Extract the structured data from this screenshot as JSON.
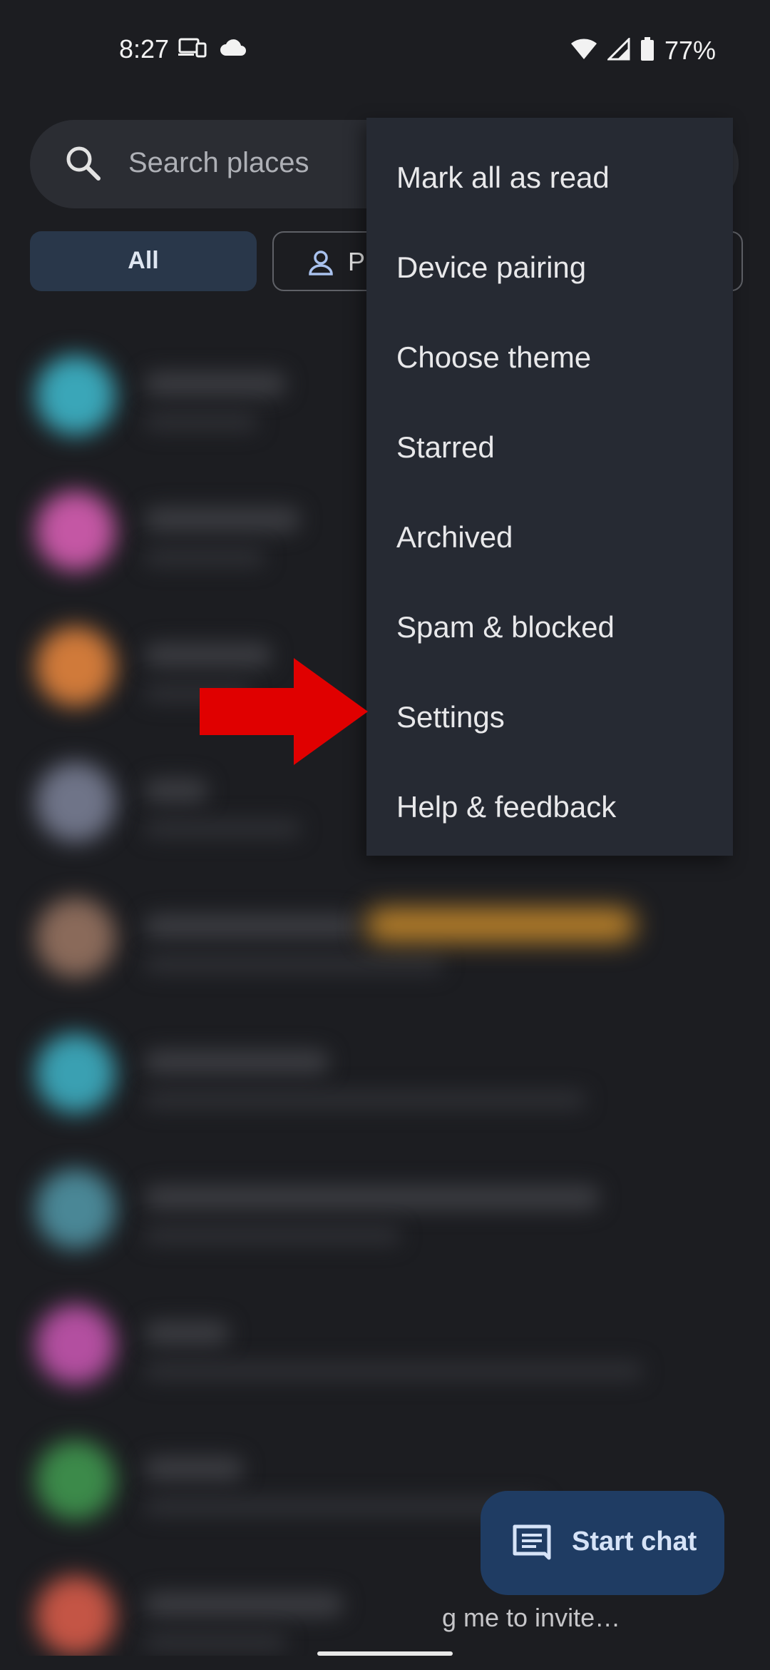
{
  "status_bar": {
    "time": "8:27",
    "battery": "77%",
    "icons": [
      "devices-icon",
      "cloud-icon",
      "wifi-icon",
      "signal-icon",
      "battery-icon"
    ]
  },
  "search": {
    "placeholder": "Search places"
  },
  "filters": {
    "all_label": "All",
    "people_label": "P"
  },
  "menu": {
    "items": [
      "Mark all as read",
      "Device pairing",
      "Choose theme",
      "Starred",
      "Archived",
      "Spam & blocked",
      "Settings",
      "Help & feedback"
    ]
  },
  "fab": {
    "label": "Start chat",
    "icon": "chat-icon"
  },
  "snippet": {
    "text": "g me to invite…"
  },
  "colors": {
    "accent_fab": "#1f3c63",
    "arrow": "#e00000",
    "menu_bg": "#262a33",
    "chip_selected": "#29374a"
  }
}
